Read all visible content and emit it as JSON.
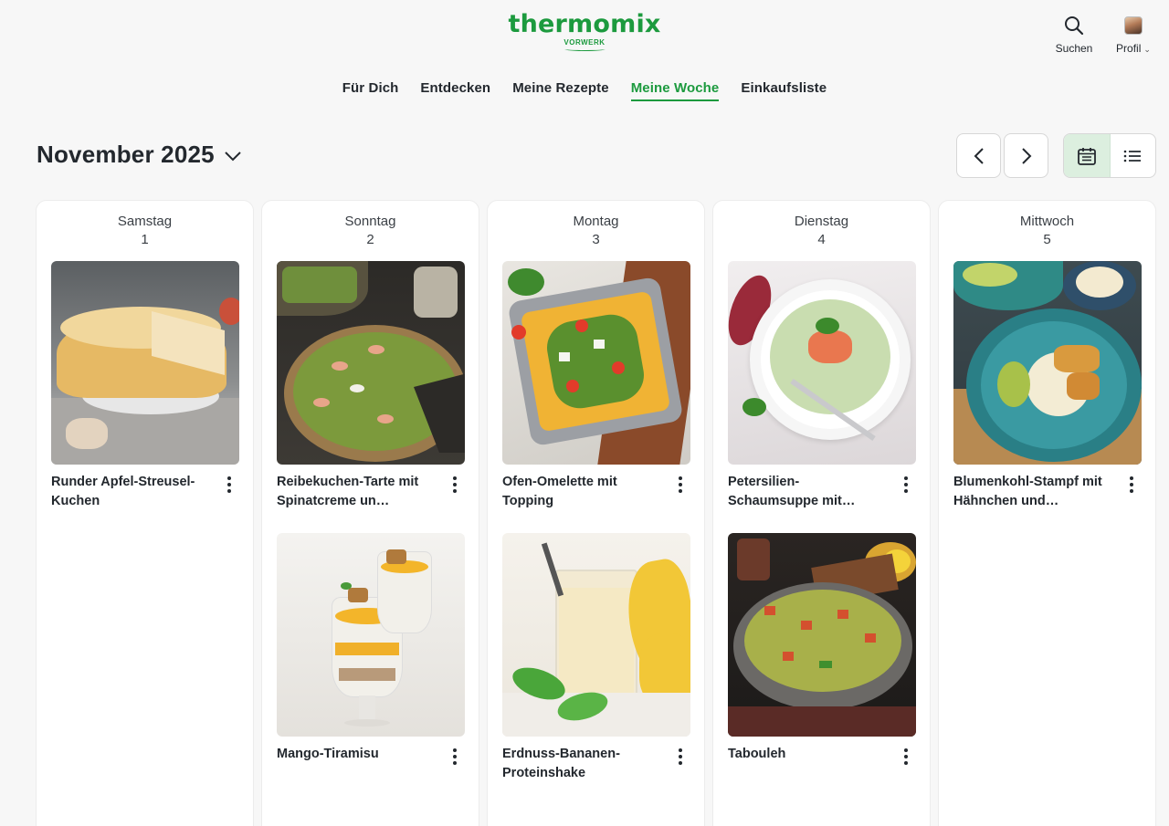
{
  "header": {
    "logo_text": "thermomix",
    "logo_sub": "VORWERK",
    "search_label": "Suchen",
    "profile_label": "Profil"
  },
  "nav": [
    {
      "label": "Für Dich",
      "active": false
    },
    {
      "label": "Entdecken",
      "active": false
    },
    {
      "label": "Meine Rezepte",
      "active": false
    },
    {
      "label": "Meine Woche",
      "active": true
    },
    {
      "label": "Einkaufsliste",
      "active": false
    }
  ],
  "toolbar": {
    "month": "November 2025",
    "view_mode": "calendar"
  },
  "colors": {
    "brand_green": "#1c9a3e",
    "active_toggle_bg": "#dcefdf",
    "page_bg": "#f7f7f7"
  },
  "days": [
    {
      "name": "Samstag",
      "num": "1",
      "recipes": [
        {
          "title": "Runder Apfel-Streusel-Kuchen",
          "image": "apple-crumble-cake"
        }
      ]
    },
    {
      "name": "Sonntag",
      "num": "2",
      "recipes": [
        {
          "title": "Reibekuchen-Tarte mit Spinatcreme un…",
          "image": "spinach-salmon-tart"
        },
        {
          "title": "Mango-Tiramisu",
          "image": "mango-tiramisu-glasses"
        }
      ]
    },
    {
      "name": "Montag",
      "num": "3",
      "recipes": [
        {
          "title": "Ofen-Omelette mit Topping",
          "image": "oven-omelette-dish"
        },
        {
          "title": "Erdnuss-Bananen-Proteinshake",
          "image": "banana-protein-shake"
        }
      ]
    },
    {
      "name": "Dienstag",
      "num": "4",
      "recipes": [
        {
          "title": "Petersilien-Schaumsuppe mit…",
          "image": "parsley-foam-soup"
        },
        {
          "title": "Tabouleh",
          "image": "tabouleh-bowl"
        }
      ]
    },
    {
      "name": "Mittwoch",
      "num": "5",
      "recipes": [
        {
          "title": "Blumenkohl-Stampf mit Hähnchen und…",
          "image": "cauliflower-mash-chicken"
        }
      ]
    }
  ]
}
